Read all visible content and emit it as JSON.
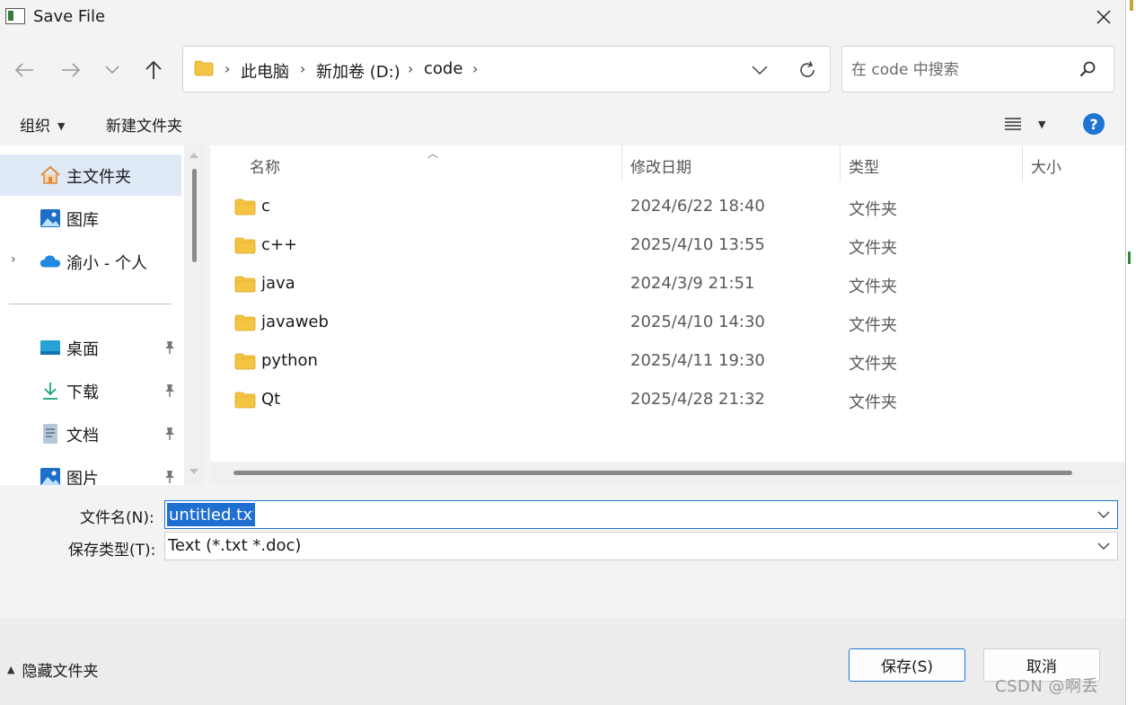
{
  "window": {
    "title": "Save File"
  },
  "address": {
    "crumbs": [
      "此电脑",
      "新加卷 (D:)",
      "code"
    ],
    "search_placeholder": "在 code 中搜索"
  },
  "toolbar": {
    "organize_label": "组织",
    "new_folder_label": "新建文件夹",
    "help_label": "?"
  },
  "nav_pane": {
    "items": [
      {
        "label": "主文件夹",
        "icon": "home-icon"
      },
      {
        "label": "图库",
        "icon": "gallery-icon"
      },
      {
        "label": "渝小 - 个人",
        "icon": "cloud-icon"
      },
      {
        "label": "桌面",
        "icon": "desktop-icon"
      },
      {
        "label": "下载",
        "icon": "download-icon"
      },
      {
        "label": "文档",
        "icon": "document-icon"
      },
      {
        "label": "图片",
        "icon": "pictures-icon"
      }
    ]
  },
  "file_list": {
    "columns": [
      "名称",
      "修改日期",
      "类型",
      "大小"
    ],
    "rows": [
      {
        "name": "c",
        "date": "2024/6/22 18:40",
        "type": "文件夹"
      },
      {
        "name": "c++",
        "date": "2025/4/10 13:55",
        "type": "文件夹"
      },
      {
        "name": "java",
        "date": "2024/3/9 21:51",
        "type": "文件夹"
      },
      {
        "name": "javaweb",
        "date": "2025/4/10 14:30",
        "type": "文件夹"
      },
      {
        "name": "python",
        "date": "2025/4/11 19:30",
        "type": "文件夹"
      },
      {
        "name": "Qt",
        "date": "2025/4/28 21:32",
        "type": "文件夹"
      }
    ]
  },
  "form": {
    "filename_label": "文件名(N):",
    "filename_value": "untitled.txt",
    "filetype_label": "保存类型(T):",
    "filetype_value": "Text (*.txt *.doc)"
  },
  "footer": {
    "hide_folders_label": "隐藏文件夹",
    "save_label": "保存(S)",
    "cancel_label": "取消",
    "watermark": "CSDN @啊丢"
  },
  "colors": {
    "accent": "#1f75d1",
    "folder": "#f4c542",
    "selection": "#e0eaf6"
  }
}
